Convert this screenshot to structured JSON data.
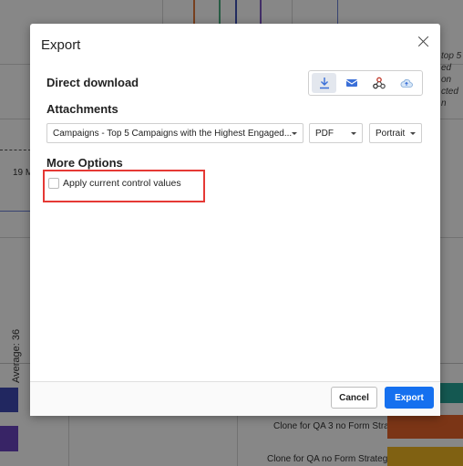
{
  "background": {
    "date_label": "19 M",
    "side_note_lines": [
      "top 5",
      "ed on",
      "cted n"
    ],
    "rotated_label": "Average: 36",
    "bar_labels": [
      "Clone for QA 3 no Form Strat",
      "Clone for QA no Form Strategy"
    ]
  },
  "dialog": {
    "title": "Export",
    "direct_download_label": "Direct download",
    "download_icons": [
      "download-icon",
      "email-icon",
      "webhook-icon",
      "cloud-upload-icon"
    ],
    "attachments_label": "Attachments",
    "attachment_select_value": "Campaigns - Top 5 Campaigns with the Highest Engaged...",
    "format_select_value": "PDF",
    "orientation_select_value": "Portrait",
    "more_options_label": "More Options",
    "apply_control_values_label": "Apply current control values",
    "apply_control_values_checked": false,
    "highlight_color": "#e53935",
    "cancel_label": "Cancel",
    "export_label": "Export",
    "accent_color": "#1570ef"
  }
}
